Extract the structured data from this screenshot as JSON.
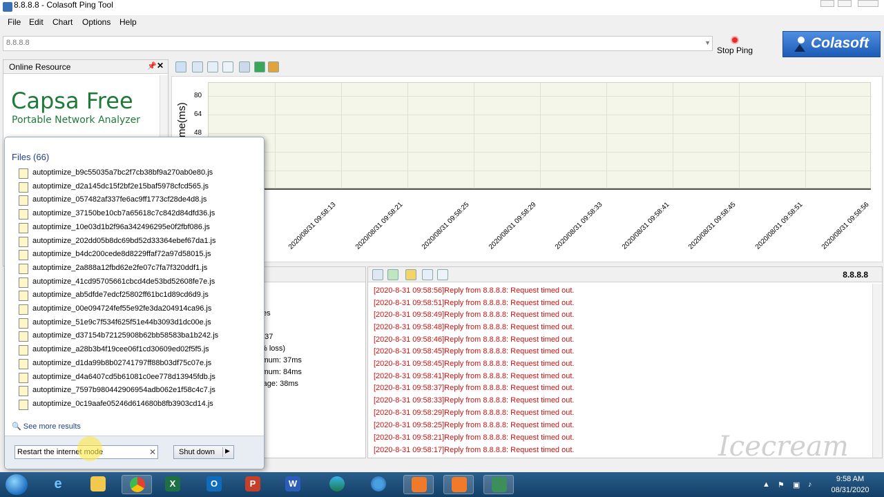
{
  "window": {
    "title": "8.8.8.8 - Colasoft Ping Tool"
  },
  "menu": [
    "File",
    "Edit",
    "Chart",
    "Options",
    "Help"
  ],
  "address": {
    "value": "8.8.8.8"
  },
  "toolbar": {
    "stop_ping_label": "Stop Ping",
    "logo_text": "Colasoft"
  },
  "left_panel": {
    "title": "Online Resource",
    "ad_title": "Capsa Free",
    "ad_subtitle": "Portable Network Analyzer"
  },
  "chart_data": {
    "type": "line",
    "ylabel": "Time(ms)",
    "yticks": [
      80,
      64,
      48
    ],
    "x": [
      "2020/08/31 09:58:13",
      "2020/08/31 09:58:21",
      "2020/08/31 09:58:25",
      "2020/08/31 09:58:29",
      "2020/08/31 09:58:33",
      "2020/08/31 09:58:41",
      "2020/08/31 09:58:45",
      "2020/08/31 09:58:51",
      "2020/08/31 09:58:56"
    ],
    "series": []
  },
  "stats": {
    "lines": [
      "tes",
      "437",
      "% loss)",
      "imum: 37ms",
      "imum: 84ms",
      "rage: 38ms"
    ]
  },
  "log": {
    "host": "8.8.8.8",
    "entries": [
      "[2020-8-31 09:58:56]Reply from 8.8.8.8: Request timed out.",
      "[2020-8-31 09:58:51]Reply from 8.8.8.8: Request timed out.",
      "[2020-8-31 09:58:49]Reply from 8.8.8.8: Request timed out.",
      "[2020-8-31 09:58:48]Reply from 8.8.8.8: Request timed out.",
      "[2020-8-31 09:58:46]Reply from 8.8.8.8: Request timed out.",
      "[2020-8-31 09:58:45]Reply from 8.8.8.8: Request timed out.",
      "[2020-8-31 09:58:45]Reply from 8.8.8.8: Request timed out.",
      "[2020-8-31 09:58:41]Reply from 8.8.8.8: Request timed out.",
      "[2020-8-31 09:58:37]Reply from 8.8.8.8: Request timed out.",
      "[2020-8-31 09:58:33]Reply from 8.8.8.8: Request timed out.",
      "[2020-8-31 09:58:29]Reply from 8.8.8.8: Request timed out.",
      "[2020-8-31 09:58:25]Reply from 8.8.8.8: Request timed out.",
      "[2020-8-31 09:58:21]Reply from 8.8.8.8: Request timed out.",
      "[2020-8-31 09:58:17]Reply from 8.8.8.8: Request timed out."
    ]
  },
  "start_menu": {
    "files_heading": "Files (66)",
    "files": [
      "autoptimize_b9c55035a7bc2f7cb38bf9a270ab0e80.js",
      "autoptimize_d2a145dc15f2bf2e15baf5978cfcd565.js",
      "autoptimize_057482af337fe6ac9ff1773cf28de4d8.js",
      "autoptimize_37150be10cb7a65618c7c842d84dfd36.js",
      "autoptimize_10e03d1b2f96a342496295e0f2fbf086.js",
      "autoptimize_202dd05b8dc69bd52d33364ebef67da1.js",
      "autoptimize_b4dc200cede8d8229ffaf72a97d58015.js",
      "autoptimize_2a888a12fbd62e2fe07c7fa7f320ddf1.js",
      "autoptimize_41cd95705661cbcd4de53bd52608fe7e.js",
      "autoptimize_ab5dfde7edcf25802ff61bc1d89cd6d9.js",
      "autoptimize_00e094724fef55e92fe3da204914ca96.js",
      "autoptimize_51e9c7f534f625f51e44b3093d1dc00e.js",
      "autoptimize_d37154b72125908b62bb58583ba1b242.js",
      "autoptimize_a28b3b4f19cee06f1cd30609ed02f5f5.js",
      "autoptimize_d1da99b8b02741797ff88b03df75c07e.js",
      "autoptimize_d4a6407cd5b61081c0ee778d13945fdb.js",
      "autoptimize_7597b980442906954adb062e1f58c4c7.js",
      "autoptimize_0c19aafe05246d614680b8fb3903cd14.js"
    ],
    "see_more": "See more results",
    "search_value": "Restart the internet mode",
    "shutdown_label": "Shut down"
  },
  "taskbar": {
    "apps": [
      "start-orb",
      "internet-explorer",
      "file-explorer",
      "chrome",
      "excel",
      "outlook",
      "powerpoint",
      "word",
      "edge",
      "firefox",
      "app-orange",
      "camera-app",
      "network-app"
    ],
    "time": "9:58 AM",
    "date": "08/31/2020",
    "tray": [
      "CAP",
      "NUM",
      "SCRL"
    ]
  }
}
